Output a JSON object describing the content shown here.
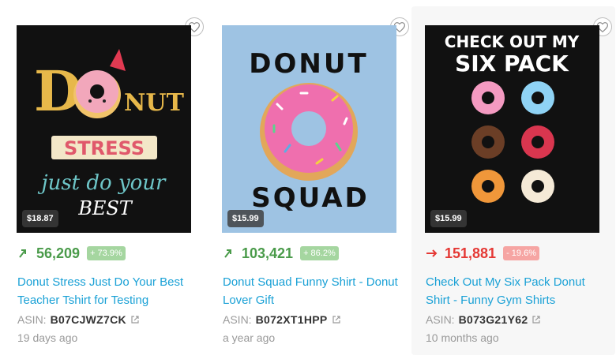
{
  "products": [
    {
      "image_text": [
        "D",
        "NUT",
        "STRESS",
        "just do your",
        "BEST"
      ],
      "price": "$18.87",
      "rank": "56,209",
      "trend": "up",
      "change": "+ 73.9%",
      "title": "Donut Stress Just Do Your Best Teacher Tshirt for Testing",
      "asin_label": "ASIN:",
      "asin": "B07CJWZ7CK",
      "age": "19 days ago",
      "background": "#111111"
    },
    {
      "image_text": [
        "DONUT",
        "SQUAD"
      ],
      "price": "$15.99",
      "rank": "103,421",
      "trend": "up",
      "change": "+ 86.2%",
      "title": "Donut Squad Funny Shirt - Donut Lover Gift",
      "asin_label": "ASIN:",
      "asin": "B072XT1HPP",
      "age": "a year ago",
      "background": "#9ec3e3"
    },
    {
      "image_text": [
        "CHECK OUT MY",
        "SIX PACK"
      ],
      "price": "$15.99",
      "rank": "151,881",
      "trend": "down",
      "change": "- 19.6%",
      "title": "Check Out My Six Pack Donut Shirt - Funny Gym Shirts",
      "asin_label": "ASIN:",
      "asin": "B073G21Y62",
      "age": "10 months ago",
      "background": "#111111"
    }
  ],
  "colors": {
    "link": "#1aa1d6",
    "up": "#4a9b4a",
    "down": "#e53935",
    "muted": "#9a9a9a"
  },
  "icons": {
    "favorite": "heart-outline-icon",
    "trend_up": "arrow-up-right-icon",
    "trend_down": "arrow-right-icon",
    "external": "external-link-icon"
  }
}
